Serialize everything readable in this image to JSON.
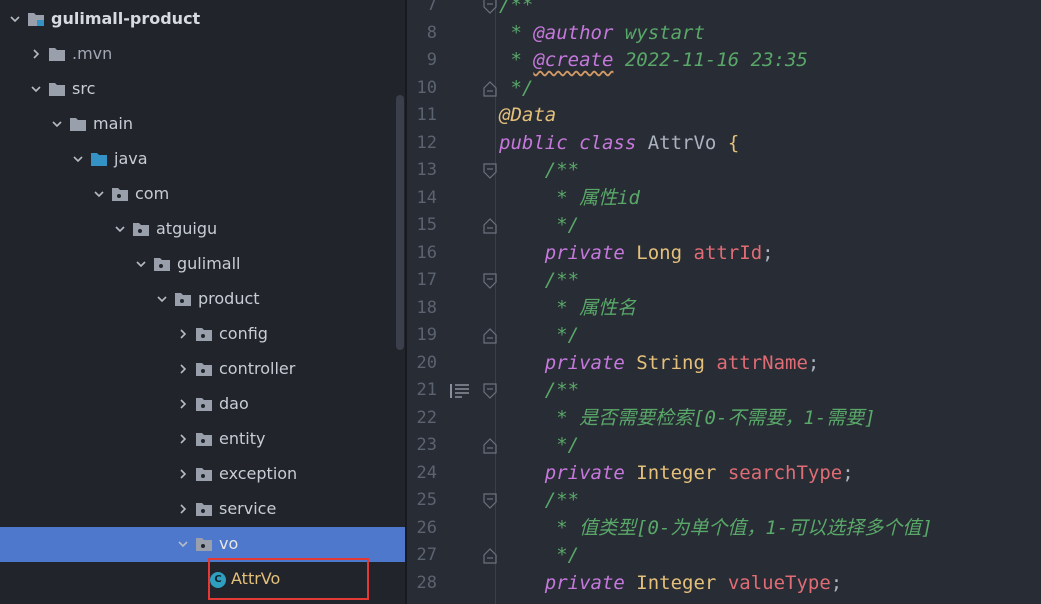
{
  "project_tree": {
    "items": [
      {
        "label": "gulimall-product",
        "depth": 0,
        "expanded": true,
        "type": "module"
      },
      {
        "label": ".mvn",
        "depth": 1,
        "expanded": false,
        "type": "folder"
      },
      {
        "label": "src",
        "depth": 1,
        "expanded": true,
        "type": "folder"
      },
      {
        "label": "main",
        "depth": 2,
        "expanded": true,
        "type": "folder"
      },
      {
        "label": "java",
        "depth": 3,
        "expanded": true,
        "type": "source-folder"
      },
      {
        "label": "com",
        "depth": 4,
        "expanded": true,
        "type": "package"
      },
      {
        "label": "atguigu",
        "depth": 5,
        "expanded": true,
        "type": "package"
      },
      {
        "label": "gulimall",
        "depth": 6,
        "expanded": true,
        "type": "package"
      },
      {
        "label": "product",
        "depth": 7,
        "expanded": true,
        "type": "package"
      },
      {
        "label": "config",
        "depth": 8,
        "expanded": false,
        "type": "package"
      },
      {
        "label": "controller",
        "depth": 8,
        "expanded": false,
        "type": "package"
      },
      {
        "label": "dao",
        "depth": 8,
        "expanded": false,
        "type": "package"
      },
      {
        "label": "entity",
        "depth": 8,
        "expanded": false,
        "type": "package"
      },
      {
        "label": "exception",
        "depth": 8,
        "expanded": false,
        "type": "package"
      },
      {
        "label": "service",
        "depth": 8,
        "expanded": false,
        "type": "package"
      },
      {
        "label": "vo",
        "depth": 8,
        "expanded": true,
        "type": "package",
        "selected": true
      },
      {
        "label": "AttrVo",
        "depth": 9,
        "type": "class",
        "class_badge": "C"
      }
    ]
  },
  "editor": {
    "lines": [
      {
        "n": "7",
        "tokens": [
          [
            "doc",
            "/**"
          ]
        ]
      },
      {
        "n": "8",
        "tokens": [
          [
            "doc",
            " * "
          ],
          [
            "tag",
            "@author"
          ],
          [
            "doc",
            " wystart"
          ]
        ]
      },
      {
        "n": "9",
        "tokens": [
          [
            "doc",
            " * "
          ],
          [
            "tag-sq",
            "@create"
          ],
          [
            "doc",
            " 2022-11-16 23:35"
          ]
        ]
      },
      {
        "n": "10",
        "tokens": [
          [
            "doc",
            " */"
          ]
        ]
      },
      {
        "n": "11",
        "tokens": [
          [
            "ann",
            "@Data"
          ]
        ]
      },
      {
        "n": "12",
        "tokens": [
          [
            "kw",
            "public"
          ],
          [
            "plain",
            " "
          ],
          [
            "kw",
            "class"
          ],
          [
            "plain",
            " AttrVo "
          ],
          [
            "brace",
            "{"
          ]
        ]
      },
      {
        "n": "13",
        "tokens": [
          [
            "doc",
            "    /**"
          ]
        ]
      },
      {
        "n": "14",
        "tokens": [
          [
            "doc",
            "     * 属性id"
          ]
        ]
      },
      {
        "n": "15",
        "tokens": [
          [
            "doc",
            "     */"
          ]
        ]
      },
      {
        "n": "16",
        "tokens": [
          [
            "plain",
            "    "
          ],
          [
            "kw",
            "private"
          ],
          [
            "plain",
            " "
          ],
          [
            "type",
            "Long"
          ],
          [
            "plain",
            " "
          ],
          [
            "field",
            "attrId"
          ],
          [
            "plain",
            ";"
          ]
        ]
      },
      {
        "n": "17",
        "tokens": [
          [
            "doc",
            "    /**"
          ]
        ]
      },
      {
        "n": "18",
        "tokens": [
          [
            "doc",
            "     * 属性名"
          ]
        ]
      },
      {
        "n": "19",
        "tokens": [
          [
            "doc",
            "     */"
          ]
        ]
      },
      {
        "n": "20",
        "tokens": [
          [
            "plain",
            "    "
          ],
          [
            "kw",
            "private"
          ],
          [
            "plain",
            " "
          ],
          [
            "type",
            "String"
          ],
          [
            "plain",
            " "
          ],
          [
            "field",
            "attrName"
          ],
          [
            "plain",
            ";"
          ]
        ]
      },
      {
        "n": "21",
        "tokens": [
          [
            "doc",
            "    /**"
          ]
        ]
      },
      {
        "n": "22",
        "tokens": [
          [
            "doc",
            "     * 是否需要检索[0-不需要，1-需要]"
          ]
        ]
      },
      {
        "n": "23",
        "tokens": [
          [
            "doc",
            "     */"
          ]
        ]
      },
      {
        "n": "24",
        "tokens": [
          [
            "plain",
            "    "
          ],
          [
            "kw",
            "private"
          ],
          [
            "plain",
            " "
          ],
          [
            "type",
            "Integer"
          ],
          [
            "plain",
            " "
          ],
          [
            "field",
            "searchType"
          ],
          [
            "plain",
            ";"
          ]
        ]
      },
      {
        "n": "25",
        "tokens": [
          [
            "doc",
            "    /**"
          ]
        ]
      },
      {
        "n": "26",
        "tokens": [
          [
            "doc",
            "     * 值类型[0-为单个值，1-可以选择多个值]"
          ]
        ]
      },
      {
        "n": "27",
        "tokens": [
          [
            "doc",
            "     */"
          ]
        ]
      },
      {
        "n": "28",
        "tokens": [
          [
            "plain",
            "    "
          ],
          [
            "kw",
            "private"
          ],
          [
            "plain",
            " "
          ],
          [
            "type",
            "Integer"
          ],
          [
            "plain",
            " "
          ],
          [
            "field",
            "valueType"
          ],
          [
            "plain",
            ";"
          ]
        ]
      }
    ]
  },
  "colors": {
    "selection": "#4d78cc",
    "highlight_border": "#e53935",
    "doc_comment": "#59a869",
    "keyword": "#c678dd",
    "type": "#e5c07b",
    "field": "#e06c75"
  }
}
